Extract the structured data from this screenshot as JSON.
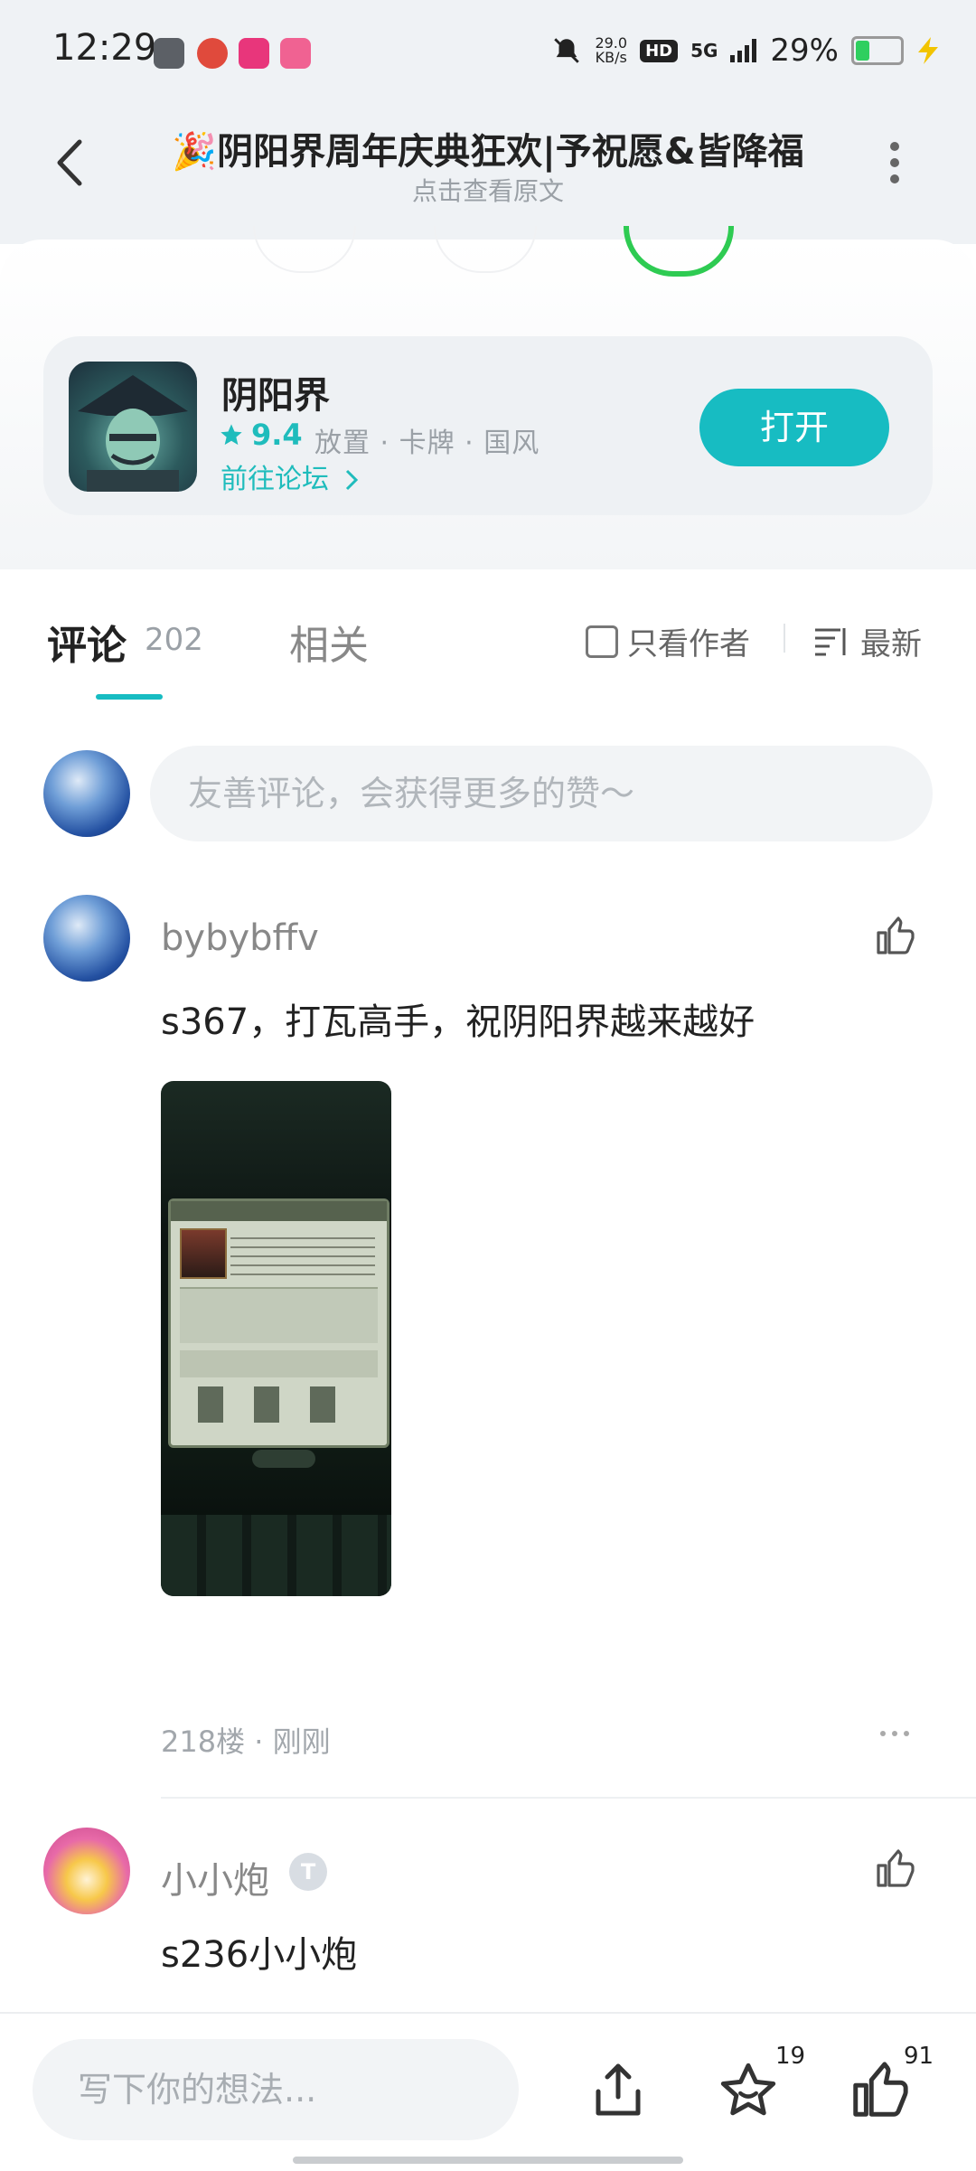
{
  "status_bar": {
    "time": "12:29",
    "net_speed_value": "29.0",
    "net_speed_unit": "KB/s",
    "hd": "HD",
    "network": "5G",
    "battery": "29%",
    "app_icons": [
      "wechat-icon",
      "maps-icon",
      "video-app-icon",
      "bilibili-icon"
    ]
  },
  "header": {
    "title": "🎉阴阳界周年庆典狂欢|予祝愿&皆降福",
    "subtitle": "点击查看原文"
  },
  "app_card": {
    "name": "阴阳界",
    "rating": "9.4",
    "tags": "放置 · 卡牌 · 国风",
    "forum_link": "前往论坛",
    "open_label": "打开"
  },
  "tabs": {
    "comments_label": "评论",
    "comments_count": "202",
    "related_label": "相关",
    "only_author": "只看作者",
    "sort_label": "最新"
  },
  "comment_input": {
    "placeholder": "友善评论，会获得更多的赞～"
  },
  "comments": [
    {
      "user": "bybybffv",
      "text": "s367，打瓦高手，祝阴阳界越来越好",
      "floor": "218楼",
      "time": "刚刚",
      "meta": "218楼 · 刚刚"
    },
    {
      "user": "小小炮",
      "text": "s236小小炮"
    }
  ],
  "bottom_bar": {
    "placeholder": "写下你的想法...",
    "favorites": "19",
    "likes": "91"
  },
  "colors": {
    "accent": "#17bcc2",
    "header_bg": "#eff2f5"
  }
}
